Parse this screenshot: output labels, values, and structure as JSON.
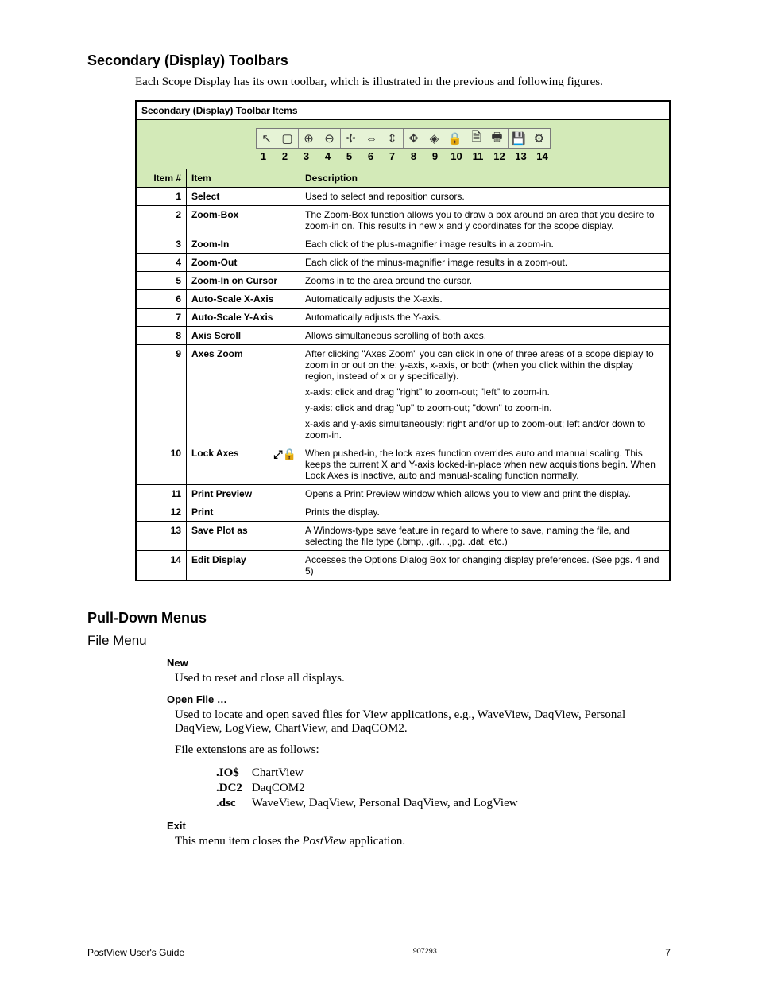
{
  "heading1": "Secondary (Display) Toolbars",
  "intro": "Each Scope Display has its own toolbar, which is illustrated in the previous and following figures.",
  "tableTitle": "Secondary (Display) Toolbar Items",
  "icons": [
    "select",
    "box",
    "zoom-in",
    "zoom-out",
    "cursor-zoom",
    "scale-x",
    "scale-y",
    "scroll",
    "axes-zoom",
    "lock",
    "preview",
    "print",
    "save",
    "edit"
  ],
  "nums": [
    "1",
    "2",
    "3",
    "4",
    "5",
    "6",
    "7",
    "8",
    "9",
    "10",
    "11",
    "12",
    "13",
    "14"
  ],
  "headers": {
    "num": "Item #",
    "item": "Item",
    "desc": "Description"
  },
  "rows": [
    {
      "n": "1",
      "item": "Select",
      "desc": [
        "Used to select and reposition cursors."
      ]
    },
    {
      "n": "2",
      "item": "Zoom-Box",
      "desc": [
        "The Zoom-Box function allows you to draw a box around an area that you desire to zoom-in on.  This results in new x and y coordinates for the scope display."
      ]
    },
    {
      "n": "3",
      "item": "Zoom-In",
      "desc": [
        "Each click of the plus-magnifier image results in a zoom-in."
      ]
    },
    {
      "n": "4",
      "item": "Zoom-Out",
      "desc": [
        "Each click of the minus-magnifier image results in a zoom-out."
      ]
    },
    {
      "n": "5",
      "item": "Zoom-In on Cursor",
      "desc": [
        "Zooms in to the area around the cursor."
      ]
    },
    {
      "n": "6",
      "item": "Auto-Scale X-Axis",
      "desc": [
        "Automatically adjusts the X-axis."
      ]
    },
    {
      "n": "7",
      "item": "Auto-Scale Y-Axis",
      "desc": [
        "Automatically adjusts the Y-axis."
      ]
    },
    {
      "n": "8",
      "item": "Axis Scroll",
      "desc": [
        "Allows simultaneous scrolling of both axes."
      ]
    },
    {
      "n": "9",
      "item": "Axes Zoom",
      "desc": [
        "After clicking \"Axes Zoom\" you can click in one of three areas of a scope display to zoom in or out on the: y-axis, x-axis, or both (when you click within the display region, instead of x or y specifically).",
        "x-axis: click and drag \"right\" to zoom-out; \"left\" to zoom-in.",
        "y-axis: click and drag \"up\" to zoom-out; \"down\" to zoom-in.",
        "x-axis and y-axis simultaneously: right and/or up to zoom-out; left and/or down to zoom-in."
      ]
    },
    {
      "n": "10",
      "item": "Lock Axes",
      "lock": true,
      "desc": [
        "When pushed-in, the lock axes function overrides auto and manual scaling.  This keeps the current X and Y-axis locked-in-place when new acquisitions begin.\nWhen Lock Axes is inactive, auto and manual-scaling function normally."
      ]
    },
    {
      "n": "11",
      "item": "Print Preview",
      "desc": [
        "Opens a Print Preview window which allows you to view and print the display."
      ]
    },
    {
      "n": "12",
      "item": "Print",
      "desc": [
        "Prints the display."
      ]
    },
    {
      "n": "13",
      "item": "Save Plot as",
      "desc": [
        "A Windows-type save feature in regard to where to save, naming the file, and selecting the file type (.bmp, .gif., .jpg. .dat, etc.)"
      ]
    },
    {
      "n": "14",
      "item": "Edit Display",
      "desc": [
        "Accesses the Options Dialog Box for changing display preferences.  (See pgs. 4 and 5)"
      ]
    }
  ],
  "heading2": "Pull-Down Menus",
  "subheading": "File Menu",
  "menu": {
    "new": {
      "title": "New",
      "desc": "Used to reset and close all displays."
    },
    "open": {
      "title": "Open File …",
      "desc1": "Used to locate and open saved files for View applications, e.g., WaveView, DaqView, Personal DaqView, LogView, ChartView, and DaqCOM2.",
      "desc2": "File extensions are as follows:",
      "exts": [
        {
          "ext": ".IO$",
          "app": "ChartView"
        },
        {
          "ext": ".DC2",
          "app": "DaqCOM2"
        },
        {
          "ext": ".dsc",
          "app": "WaveView, DaqView, Personal DaqView, and LogView"
        }
      ]
    },
    "exit": {
      "title": "Exit",
      "desc_pre": "This menu item closes the ",
      "desc_em": "PostView",
      "desc_post": " application."
    }
  },
  "footer": {
    "left": "PostView User's Guide",
    "mid": "907293",
    "right": "7"
  }
}
